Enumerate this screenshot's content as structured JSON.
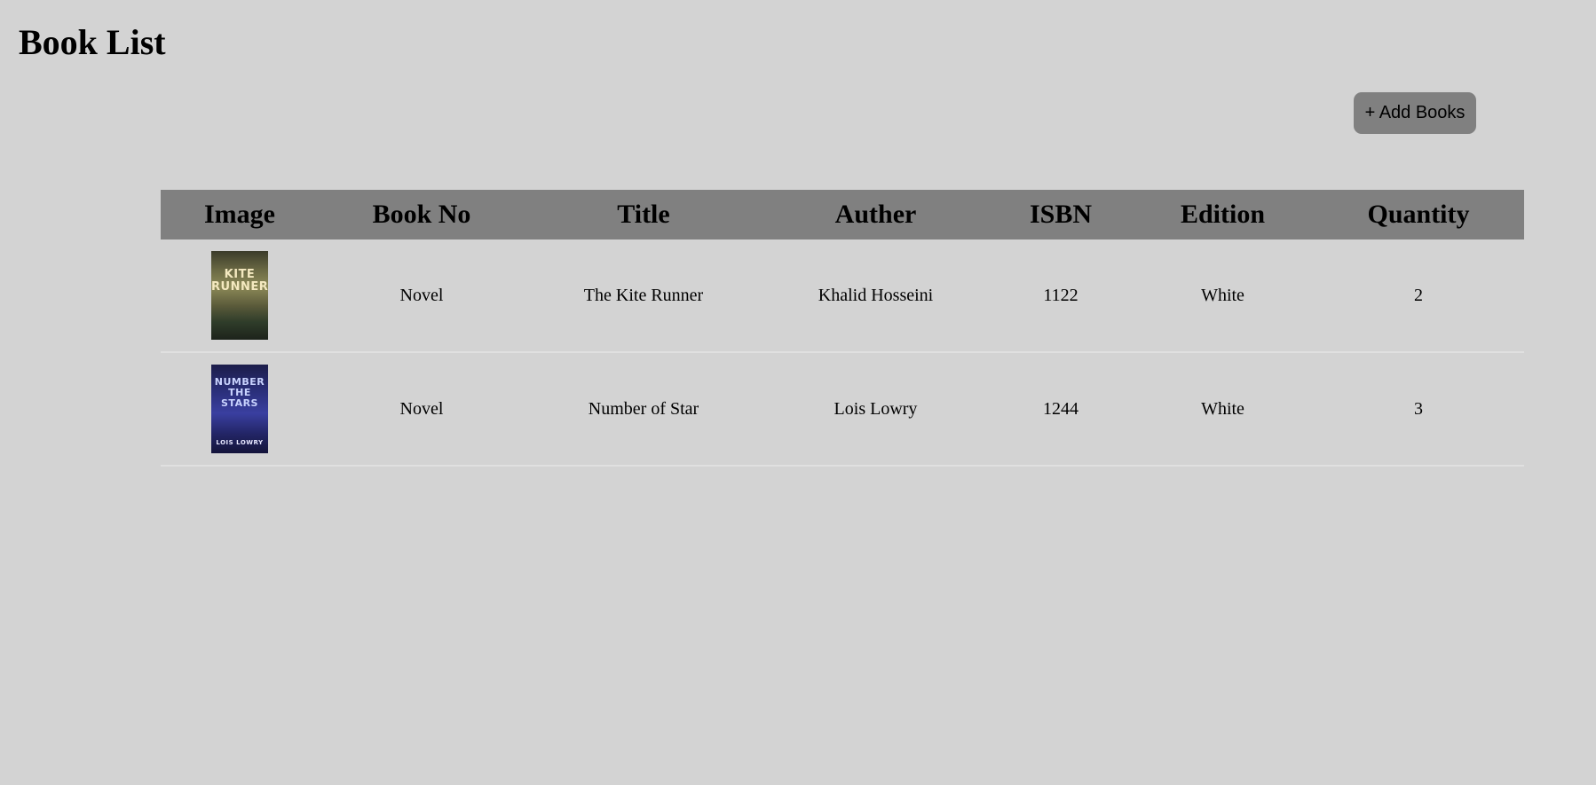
{
  "page": {
    "title": "Book List"
  },
  "toolbar": {
    "add_label": "+ Add Books"
  },
  "table": {
    "headers": [
      "Image",
      "Book No",
      "Title",
      "Auther",
      "ISBN",
      "Edition",
      "Quantity"
    ],
    "rows": [
      {
        "cover": "KITE RUNNER",
        "book_no": "Novel",
        "title": "The Kite Runner",
        "author": "Khalid Hosseini",
        "isbn": "1122",
        "edition": "White",
        "quantity": "2"
      },
      {
        "cover": "NUMBER THE STARS",
        "cover_author": "LOIS LOWRY",
        "book_no": "Novel",
        "title": "Number of Star",
        "author": "Lois Lowry",
        "isbn": "1244",
        "edition": "White",
        "quantity": "3"
      }
    ]
  },
  "colors": {
    "background": "#d3d3d3",
    "header_bg": "#808080",
    "button_bg": "#808080",
    "row_divider": "#e0e0e0"
  }
}
